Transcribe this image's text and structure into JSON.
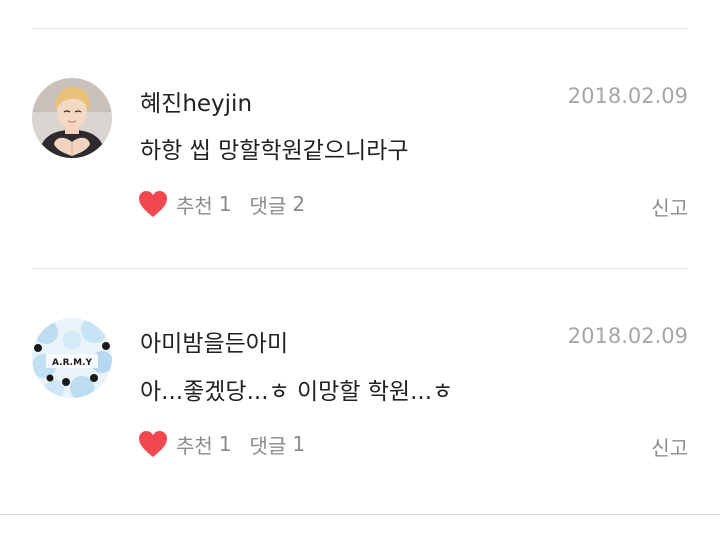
{
  "comments": [
    {
      "author": "혜진heyjin",
      "date": "2018.02.09",
      "text": "하항 씹 망할학원같으니라구",
      "like_label": "추천",
      "like_count": "1",
      "reply_label": "댓글",
      "reply_count": "2",
      "report_label": "신고",
      "avatar_icon": "profile-photo-heart-hands",
      "heart_color": "#f0484e"
    },
    {
      "author": "아미밤을든아미",
      "date": "2018.02.09",
      "text": "아...좋겠당...ㅎ 이망할 학원...ㅎ",
      "like_label": "추천",
      "like_count": "1",
      "reply_label": "댓글",
      "reply_count": "1",
      "report_label": "신고",
      "avatar_icon": "army-bomb-profile",
      "avatar_text": "A.R.M.Y",
      "heart_color": "#f0484e"
    }
  ]
}
